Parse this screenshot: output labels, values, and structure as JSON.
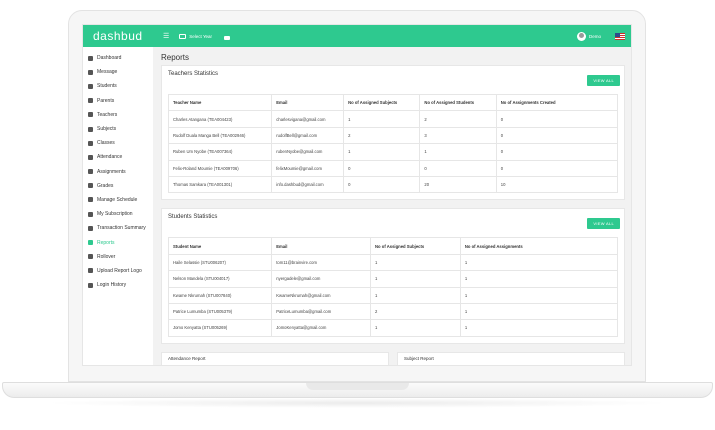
{
  "app": {
    "logo": "dashbud"
  },
  "topbar": {
    "school_year_label": "Select Year",
    "user_name": "Demo"
  },
  "sidebar": {
    "items": [
      {
        "label": "Dashboard",
        "icon": "home-icon"
      },
      {
        "label": "Message",
        "icon": "mail-icon"
      },
      {
        "label": "Students",
        "icon": "user-icon"
      },
      {
        "label": "Parents",
        "icon": "users-icon"
      },
      {
        "label": "Teachers",
        "icon": "teacher-icon"
      },
      {
        "label": "Subjects",
        "icon": "book-icon"
      },
      {
        "label": "Classes",
        "icon": "class-icon"
      },
      {
        "label": "Attendance",
        "icon": "calendar-icon"
      },
      {
        "label": "Assignments",
        "icon": "clipboard-icon"
      },
      {
        "label": "Grades",
        "icon": "grade-icon"
      },
      {
        "label": "Manage Schedule",
        "icon": "schedule-icon"
      },
      {
        "label": "My Subscription",
        "icon": "subscription-icon"
      },
      {
        "label": "Transaction Summary",
        "icon": "transaction-icon"
      },
      {
        "label": "Reports",
        "icon": "chart-icon",
        "active": true
      },
      {
        "label": "Rollover",
        "icon": "rollover-icon"
      },
      {
        "label": "Upload Report Logo",
        "icon": "image-icon"
      },
      {
        "label": "Login History",
        "icon": "history-icon"
      }
    ],
    "active_color": "#2ec98f"
  },
  "main": {
    "title": "Reports",
    "teachers": {
      "title": "Teachers Statistics",
      "view_all": "VIEW ALL",
      "columns": [
        "Teacher Name",
        "Email",
        "No of Assigned Subjects",
        "No of Assigned Students",
        "No of Assignments Created"
      ],
      "rows": [
        [
          "Charles Atangana (TEA004423)",
          "charlesvigana@gmail.com",
          "1",
          "2",
          "0"
        ],
        [
          "Rudolf Duala Manga Bell (TEA002946)",
          "rudolfBell@gmail.com",
          "2",
          "3",
          "0"
        ],
        [
          "Ruben Um Nyobe (TEA007364)",
          "rubenNyobe@gmail.com",
          "1",
          "1",
          "0"
        ],
        [
          "Felix-Roland Moumie (TEA009706)",
          "felixMoumie@gmail.com",
          "0",
          "0",
          "0"
        ],
        [
          "Thomas Samkara (TEA001301)",
          "info.dashbud@gmail.com",
          "0",
          "20",
          "10"
        ]
      ]
    },
    "students": {
      "title": "Students Statistics",
      "view_all": "VIEW ALL",
      "columns": [
        "Student Name",
        "Email",
        "No of Assigned Subjects",
        "No of Assigned Assignments"
      ],
      "rows": [
        [
          "Haile Selassie (STU006207)",
          "tom11@brainvire.com",
          "1",
          "1"
        ],
        [
          "Nelson Mandela (STU004017)",
          "nyergadele@gmail.com",
          "1",
          "1"
        ],
        [
          "Kwame Nkrumah (STU007840)",
          "KwameNkrumah@gmail.com",
          "1",
          "1"
        ],
        [
          "Patrice Lumumba (STU005379)",
          "PatriceLumumba@gmail.com",
          "2",
          "1"
        ],
        [
          "Jomo Kenyatta (STU005269)",
          "JomoKenyatta@gmail.com",
          "1",
          "1"
        ]
      ]
    },
    "attendance_report": "Attendance Report",
    "subject_report": "Subject Report"
  },
  "colors": {
    "accent": "#2ec98f"
  }
}
